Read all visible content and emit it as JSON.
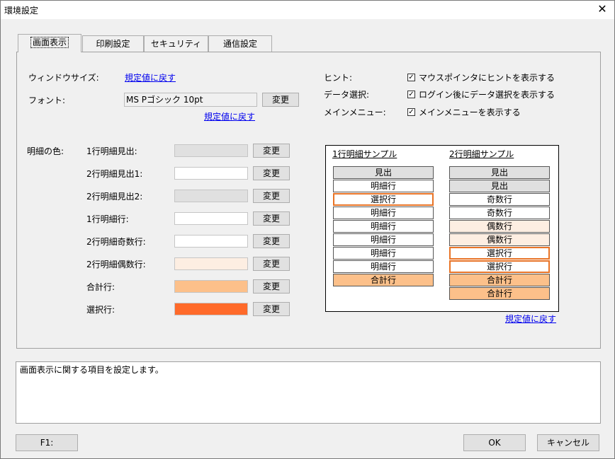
{
  "window": {
    "title": "環境設定",
    "close": "✕"
  },
  "tabs": [
    "画面表示",
    "印刷設定",
    "セキュリティ",
    "通信設定"
  ],
  "left": {
    "window_size_label": "ウィンドウサイズ:",
    "window_size_link": "規定値に戻す",
    "font_label": "フォント:",
    "font_value": "MS Pゴシック 10pt",
    "font_change": "変更",
    "font_link": "規定値に戻す"
  },
  "colors": {
    "section_label": "明細の色:",
    "change": "変更",
    "rows": [
      {
        "label": "1行明細見出:",
        "color": "#e0e0e0"
      },
      {
        "label": "2行明細見出1:",
        "color": "#ffffff"
      },
      {
        "label": "2行明細見出2:",
        "color": "#e0e0e0"
      },
      {
        "label": "1行明細行:",
        "color": "#ffffff"
      },
      {
        "label": "2行明細奇数行:",
        "color": "#ffffff"
      },
      {
        "label": "2行明細偶数行:",
        "color": "#fdeee2"
      },
      {
        "label": "合計行:",
        "color": "#fcc08a"
      },
      {
        "label": "選択行:",
        "color": "#ff6a2a"
      }
    ]
  },
  "options": {
    "hint_label": "ヒント:",
    "hint_text": "マウスポインタにヒントを表示する",
    "data_label": "データ選択:",
    "data_text": "ログイン後にデータ選択を表示する",
    "menu_label": "メインメニュー:",
    "menu_text": "メインメニューを表示する",
    "checked": "✓"
  },
  "sample": {
    "title1": "1行明細サンプル",
    "title2": "2行明細サンプル",
    "col1": [
      {
        "text": "見出",
        "kind": "header"
      },
      {
        "text": "明細行",
        "kind": "row"
      },
      {
        "text": "選択行",
        "kind": "sel"
      },
      {
        "text": "明細行",
        "kind": "row"
      },
      {
        "text": "明細行",
        "kind": "row"
      },
      {
        "text": "明細行",
        "kind": "row"
      },
      {
        "text": "明細行",
        "kind": "row"
      },
      {
        "text": "明細行",
        "kind": "row"
      },
      {
        "text": "合計行",
        "kind": "total"
      }
    ],
    "col2": [
      {
        "text": "見出",
        "kind": "header2a"
      },
      {
        "text": "見出",
        "kind": "header"
      },
      {
        "text": "奇数行",
        "kind": "row"
      },
      {
        "text": "奇数行",
        "kind": "row"
      },
      {
        "text": "偶数行",
        "kind": "even"
      },
      {
        "text": "偶数行",
        "kind": "even"
      },
      {
        "text": "選択行",
        "kind": "sel"
      },
      {
        "text": "選択行",
        "kind": "sel"
      },
      {
        "text": "合計行",
        "kind": "total"
      },
      {
        "text": "合計行",
        "kind": "total"
      }
    ],
    "reset_link": "規定値に戻す"
  },
  "description": "画面表示に関する項目を設定します。",
  "footer": {
    "f1": "F1:",
    "ok": "OK",
    "cancel": "キャンセル"
  }
}
